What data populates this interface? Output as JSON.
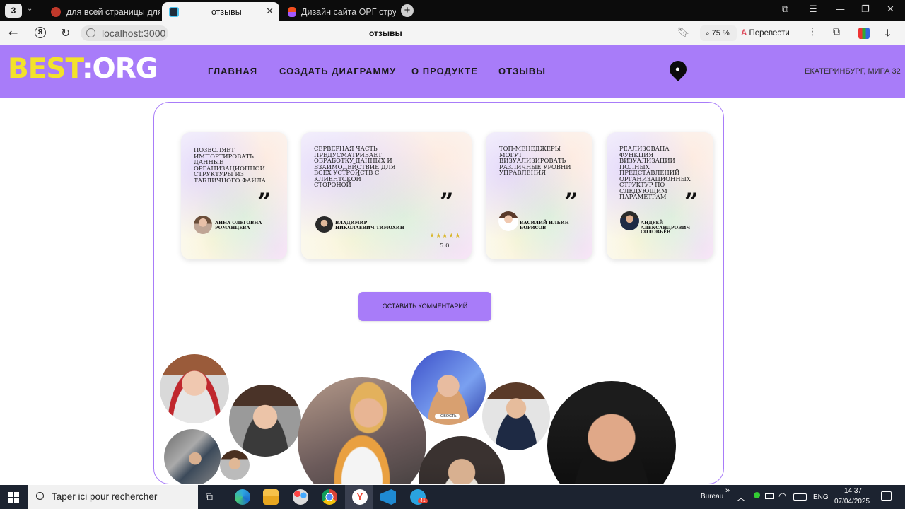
{
  "browser": {
    "tab_count": "3",
    "tabs": [
      {
        "label": "для всей страницы для уі",
        "color": "#c0392b"
      },
      {
        "label": "отзывы",
        "color": "#2a8bd6"
      },
      {
        "label": "Дизайн сайта ОРГ структ",
        "color": "#f24e1e"
      }
    ],
    "url": "localhost:3000",
    "page_title": "отзывы",
    "zoom": "75 %",
    "translate_label": "Перевести"
  },
  "header": {
    "logo_part1": "BEST",
    "logo_part2": ":ORG",
    "nav": [
      "ГЛАВНАЯ",
      "СОЗДАТЬ ДИАГРАММУ",
      "О ПРОДУКТЕ",
      "ОТЗЫВЫ"
    ],
    "address": "ЕКАТЕРИНБУРГ, МИРА 32"
  },
  "reviews": [
    {
      "text": "ПОЗВОЛЯЕТ ИМПОРТИРОВАТЬ ДАННЫЕ ОРГАНИЗАЦИОННОЙ СТРУКТУРЫ ИЗ ТАБЛИЧНОГО ФАЙЛА.",
      "author": "АННА ОЛЕГОВНА РОМАНЦЕВА"
    },
    {
      "text": "СЕРВЕРНАЯ ЧАСТЬ ПРЕДУСМАТРИВАЕТ ОБРАБОТКУ ДАННЫХ И ВЗАИМОДЕЙСТВИЕ ДЛЯ ВСЕХ УСТРОЙСТВ С КЛИЕНТСКОЙ СТОРОНОЙ",
      "author": "ВЛАДИМИР НИКОЛАЕВИЧ ТИМОХИН",
      "stars": "★★★★★",
      "score": "5.0"
    },
    {
      "text": "ТОП-МЕНЕДЖЕРЫ МОГУТ ВИЗУАЛИЗИРОВАТЬ РАЗЛИЧНЫЕ УРОВНИ УПРАВЛЕНИЯ",
      "author": "ВАСИЛИЙ ИЛЬИН БОРИСОВ"
    },
    {
      "text": "РЕАЛИЗОВАНА ФУНКЦИЯ ВИЗУАЛИЗАЦИИ ПОЛНЫХ ПРЕДСТАВЛЕНИЙ ОРГАНИЗАЦИОННЫХ СТРУКТУР ПО СЛЕДУЮЩИМ ПАРАМЕТРАМ",
      "author": "АНДРЕЙ АЛЕКСАНДРОВИЧ СОЛОВЬЁВ"
    }
  ],
  "quote_mark": "”",
  "comment_button": "ОСТАВИТЬ КОММЕНТАРИЙ",
  "photo_badge": "НОВОСТЬ",
  "taskbar": {
    "search_placeholder": "Taper ici pour rechercher",
    "desktop_label": "Bureau",
    "language": "ENG",
    "time": "14:37",
    "date": "07/04/2025",
    "telegram_badge": "41"
  }
}
